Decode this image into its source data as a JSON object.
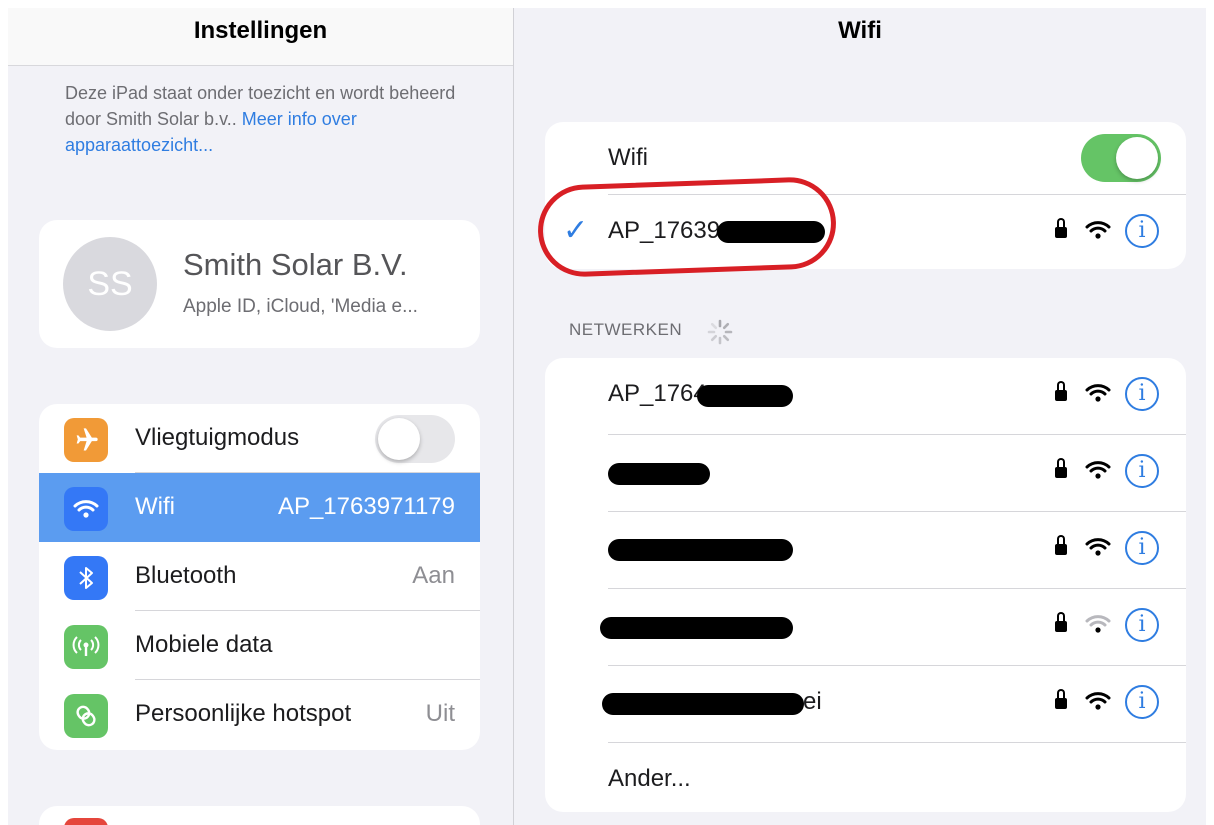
{
  "left_pane": {
    "title": "Instellingen",
    "supervision_text": "Deze iPad staat onder toezicht en wordt beheerd door Smith Solar b.v..",
    "supervision_link": "Meer info over apparaattoezicht...",
    "profile": {
      "initials": "SS",
      "name": "Smith Solar B.V.",
      "subtitle": "Apple ID, iCloud, 'Media e..."
    },
    "settings": [
      {
        "label": "Vliegtuigmodus",
        "value": "",
        "icon": "airplane-icon",
        "color": "#f19a37",
        "toggle": "off"
      },
      {
        "label": "Wifi",
        "value": "AP_1763971179",
        "icon": "wifi-icon",
        "color": "#3478f6",
        "selected": true
      },
      {
        "label": "Bluetooth",
        "value": "Aan",
        "icon": "bluetooth-icon",
        "color": "#3478f6"
      },
      {
        "label": "Mobiele data",
        "value": "",
        "icon": "antenna-icon",
        "color": "#65c466"
      },
      {
        "label": "Persoonlijke hotspot",
        "value": "Uit",
        "icon": "hotspot-icon",
        "color": "#65c466"
      }
    ]
  },
  "right_pane": {
    "title": "Wifi",
    "wifi_label": "Wifi",
    "wifi_toggle": "on",
    "connected_network": "AP_17639",
    "networks_header": "NETWERKEN",
    "networks": [
      {
        "name": "AP_1764",
        "secured": true,
        "signal": "full"
      },
      {
        "name": "",
        "secured": true,
        "signal": "full"
      },
      {
        "name": "",
        "secured": true,
        "signal": "full"
      },
      {
        "name": "",
        "secured": true,
        "signal": "weak"
      },
      {
        "name": "ei",
        "secured": true,
        "signal": "full"
      }
    ],
    "other_label": "Ander..."
  },
  "colors": {
    "accent": "#2f7de1",
    "selected_row": "#5b9cf0",
    "toggle_on": "#65c466",
    "annotation": "#d81f25"
  }
}
